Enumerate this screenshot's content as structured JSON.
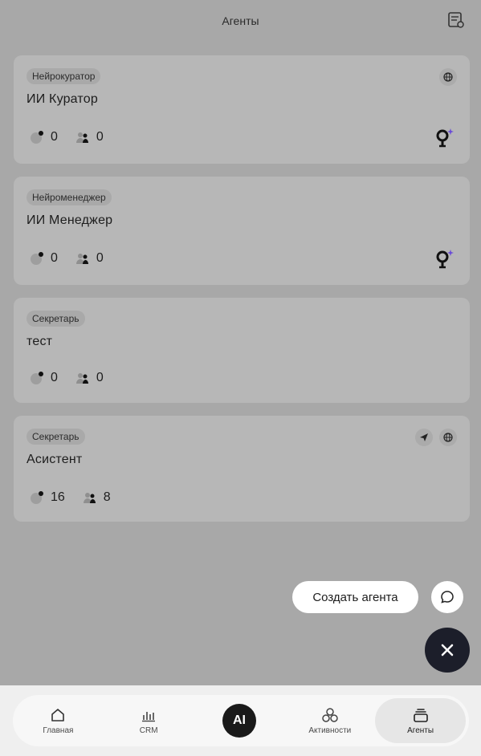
{
  "header": {
    "title": "Агенты",
    "icon": "document-settings-icon"
  },
  "agents": [
    {
      "badge": "Нейрокуратор",
      "name": "ИИ Куратор",
      "chats": "0",
      "users": "0",
      "channels": [
        "globe-icon"
      ],
      "ai_assistant": true
    },
    {
      "badge": "Нейроменеджер",
      "name": "ИИ Менеджер",
      "chats": "0",
      "users": "0",
      "channels": [],
      "ai_assistant": true
    },
    {
      "badge": "Секретарь",
      "name": "тест",
      "chats": "0",
      "users": "0",
      "channels": [],
      "ai_assistant": false
    },
    {
      "badge": "Секретарь",
      "name": "Асистент",
      "chats": "16",
      "users": "8",
      "channels": [
        "send-icon",
        "globe-icon"
      ],
      "ai_assistant": false
    }
  ],
  "fab": {
    "create_label": "Создать агента",
    "chat_icon": "chat-bubble-icon",
    "close_icon": "close-icon"
  },
  "nav": {
    "items": [
      {
        "label": "Главная",
        "icon": "home-icon"
      },
      {
        "label": "CRM",
        "icon": "bar-chart-icon"
      },
      {
        "label": "AI",
        "icon": "ai-icon"
      },
      {
        "label": "Активности",
        "icon": "activities-icon"
      },
      {
        "label": "Агенты",
        "icon": "agents-stack-icon",
        "active": true
      }
    ]
  },
  "colors": {
    "background": "#a8a8a8",
    "card": "#b7b7b7",
    "fab_dark": "#1c1e2a",
    "accent_purple": "#6a4bd8"
  }
}
